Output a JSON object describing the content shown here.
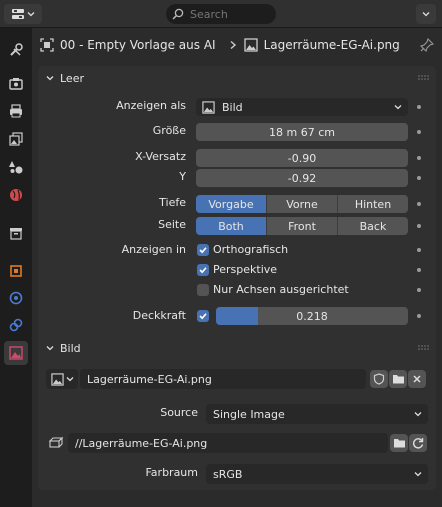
{
  "header": {
    "search_placeholder": "Search"
  },
  "breadcrumb": {
    "object": "00 - Empty Vorlage aus AI",
    "data": "Lagerräume-EG-Ai.png"
  },
  "panel_empty": {
    "title": "Leer",
    "display_as_label": "Anzeigen als",
    "display_as_value": "Bild",
    "size_label": "Größe",
    "size_value": "18 m 67 cm",
    "offset_x_label": "X-Versatz",
    "offset_x_value": "-0.90",
    "offset_y_label": "Y",
    "offset_y_value": "-0.92",
    "depth_label": "Tiefe",
    "depth_options": [
      "Vorgabe",
      "Vorne",
      "Hinten"
    ],
    "depth_selected": "Vorgabe",
    "side_label": "Seite",
    "side_options": [
      "Both",
      "Front",
      "Back"
    ],
    "side_selected": "Both",
    "show_in_label": "Anzeigen in",
    "show_ortho_label": "Orthografisch",
    "show_ortho": true,
    "show_persp_label": "Perspektive",
    "show_persp": true,
    "show_axis_label": "Nur Achsen ausgerichtet",
    "show_axis": false,
    "opacity_label": "Deckkraft",
    "opacity_enabled": true,
    "opacity_value": "0.218",
    "opacity_fraction": 0.218
  },
  "panel_image": {
    "title": "Bild",
    "image_name": "Lagerräume-EG-Ai.png",
    "source_label": "Source",
    "source_value": "Single Image",
    "filepath": "//Lagerräume-EG-Ai.png",
    "colorspace_label": "Farbraum",
    "colorspace_value": "sRGB"
  },
  "colors": {
    "accent": "#4772b3",
    "panel": "#303030",
    "field": "#545454",
    "background": "#1d1d1d"
  }
}
